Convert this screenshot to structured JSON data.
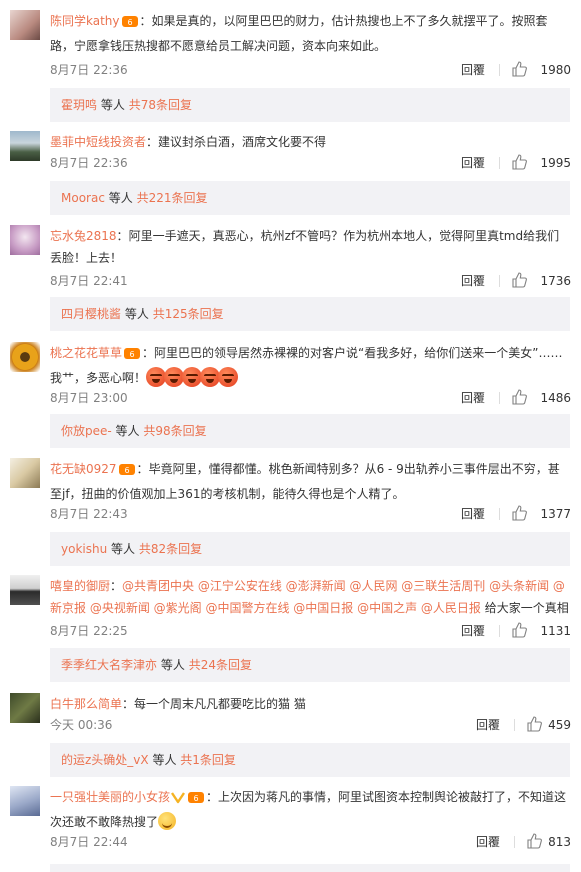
{
  "reply_label": "回覆",
  "replies_suffix_word": "等人",
  "comments": [
    {
      "user": "陈同学kathy",
      "colon": "：",
      "text": "如果是真的，以阿里巴巴的财力，估计热搜也上不了多久就摆平了。按照套路，宁愿拿钱压热搜都不愿意给员工解决问题，资本向来如此。",
      "time": "8月7日 22:36",
      "likes": "1980",
      "reply_user": "霍玥鸣",
      "reply_count": "共78条回复"
    },
    {
      "user": "墨菲中短线投资者",
      "colon": "：",
      "text": "建议封杀白酒，酒席文化要不得",
      "time": "8月7日 22:36",
      "likes": "1995",
      "reply_user": "Moorac",
      "reply_count": "共221条回复"
    },
    {
      "user": "忘水兔2818",
      "colon": "：",
      "text": "阿里一手遮天，真恶心，杭州zf不管吗？作为杭州本地人，觉得阿里真tmd给我们丢脸！上去！",
      "time": "8月7日 22:41",
      "likes": "1736",
      "reply_user": "四月樱桃酱",
      "reply_count": "共125条回复"
    },
    {
      "user": "桃之花花草草",
      "colon": "：",
      "text": "阿里巴巴的领导居然赤裸裸的对客户说“看我多好，给你们送来一个美女”……我艹，多恶心啊！",
      "time": "8月7日 23:00",
      "likes": "1486",
      "reply_user": "你放pee-",
      "reply_count": "共98条回复"
    },
    {
      "user": "花无缺0927",
      "colon": "：",
      "text": "毕竟阿里，懂得都懂。桃色新闻特别多？从6 - 9出轨养小三事件层出不穷，甚至jf，扭曲的价值观加上361的考核机制，能待久得也是个人精了。",
      "time": "8月7日 22:43",
      "likes": "1377",
      "reply_user": "yokishu",
      "reply_count": "共82条回复"
    },
    {
      "user": "嘻皇的御厨",
      "colon": "：",
      "mentions": "@共青团中央 @江宁公安在线 @澎湃新闻 @人民网 @三联生活周刊 @头条新闻 @新京报 @央视新闻 @紫光阁 @中国警方在线 @中国日报 @中国之声 @人民日报",
      "text": " 给大家一个真相",
      "time": "8月7日 22:25",
      "likes": "1131",
      "reply_user": "季季红大名李津亦",
      "reply_count": "共24条回复"
    },
    {
      "user": "白牛那么简单",
      "colon": "：",
      "text": "每一个周末凡凡都要吃比的猫 猫",
      "time": "今天 00:36",
      "likes": "459",
      "reply_user": "的运z头确处_vX",
      "reply_count": "共1条回复"
    },
    {
      "user": "一只强壮美丽的小女孩",
      "colon": "：",
      "text": "上次因为蒋凡的事情，阿里试图资本控制舆论被敲打了，不知道这次还敢不敢降热搜了",
      "time": "8月7日 22:44",
      "likes": "813"
    }
  ]
}
